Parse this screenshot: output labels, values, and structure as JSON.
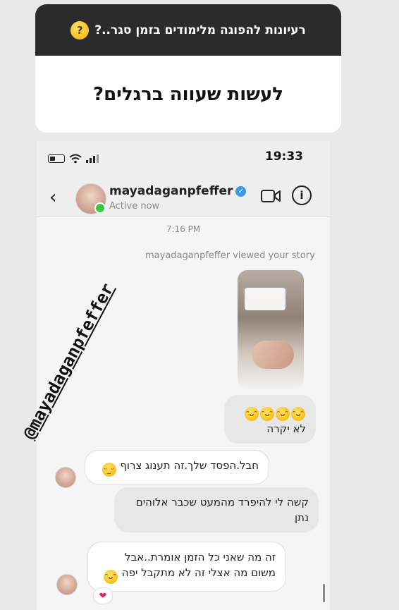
{
  "question": {
    "header_text": "רעיונות להפוגה מלימודים בזמן סגר..?",
    "header_emoji": "thinking-face",
    "answer_text": "לעשות שעווה ברגלים?"
  },
  "status_bar": {
    "time": "19:33"
  },
  "dm_header": {
    "back_icon": "chevron-left",
    "name": "mayadaganpfeffer",
    "verified_mark": "✓",
    "status": "Active now",
    "video_icon": "video-camera",
    "info_icon": "i"
  },
  "chat": {
    "timestamp": "7:16 PM",
    "viewed_story_text": "mayadaganpfeffer viewed your story",
    "mention": "@mayadaganpfeffer",
    "messages": [
      {
        "direction": "out",
        "text": "לא יקרה",
        "emojis": "😂😂😂😂"
      },
      {
        "direction": "in",
        "text": "חבל.הפסד שלך.זה תענוג צרוף",
        "emoji": "🙄"
      },
      {
        "direction": "out",
        "text": "קשה לי להיפרד מהמעט שכבר אלוהים נתן"
      },
      {
        "direction": "in",
        "text": "זה מה שאני כל הזמן אומרת..אבל משום מה אצלי זה לא מתקבל יפה",
        "emoji": "😂"
      }
    ],
    "reaction": "❤"
  },
  "colors": {
    "header_bg": "#2b2b2b",
    "verified_blue": "#3897f0",
    "online_green": "#3cc545",
    "heart": "#e0245e"
  }
}
